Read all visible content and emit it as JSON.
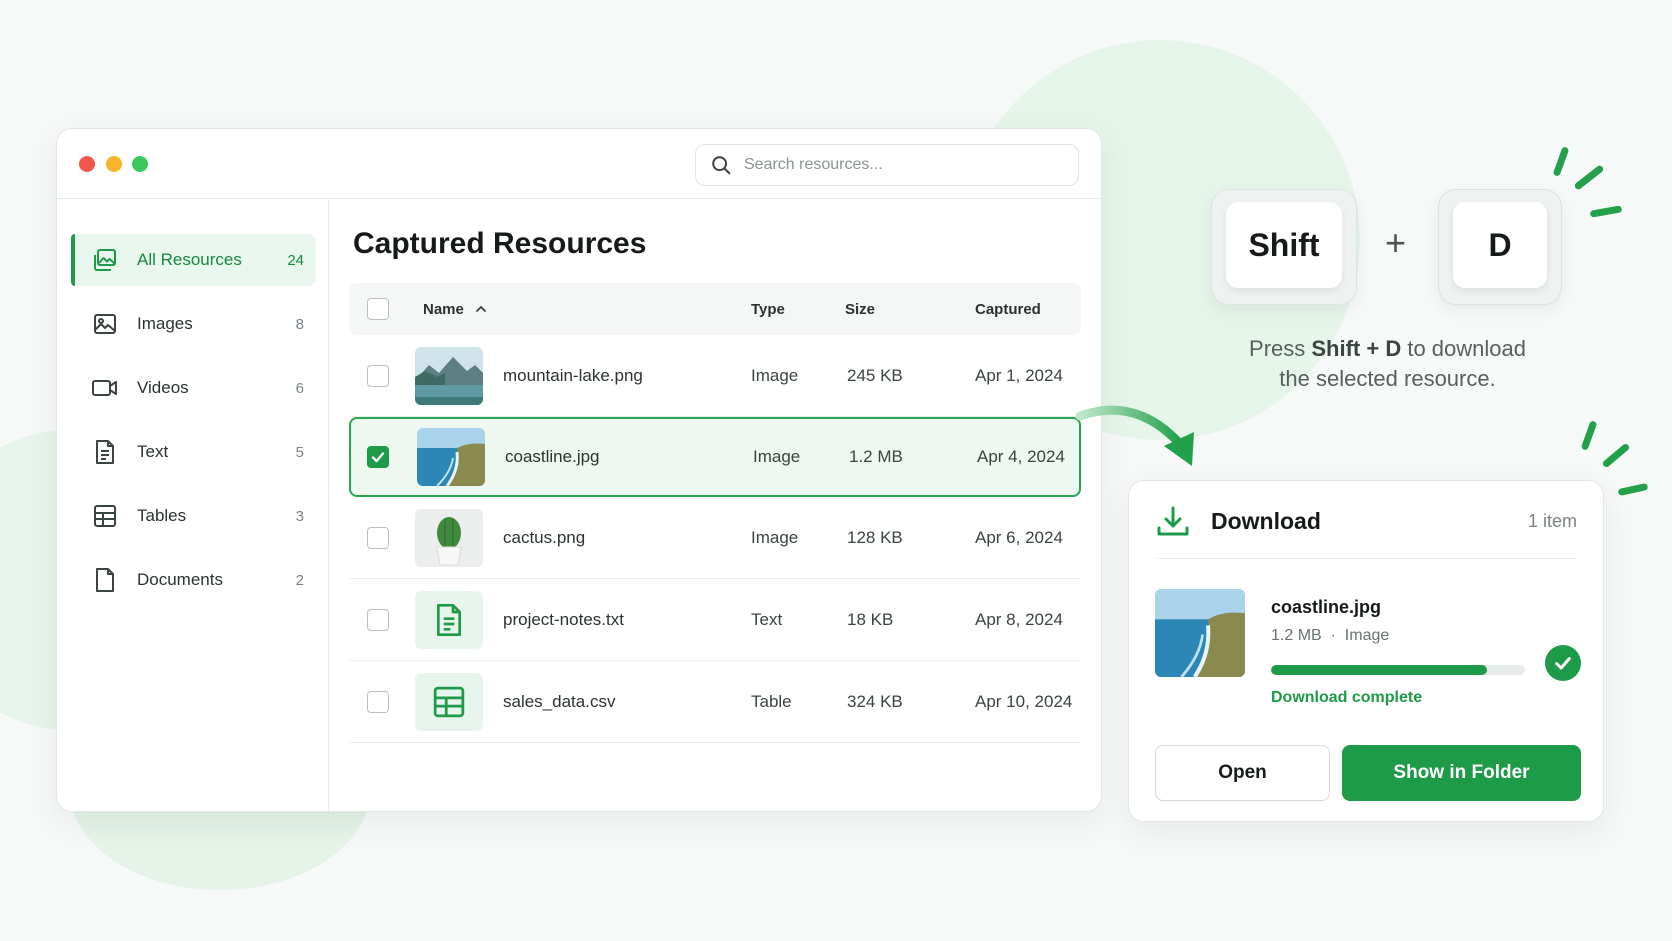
{
  "search": {
    "placeholder": "Search resources..."
  },
  "sidebar": {
    "items": [
      {
        "label": "All Resources",
        "count": "24",
        "icon": "gallery-icon"
      },
      {
        "label": "Images",
        "count": "8",
        "icon": "image-icon"
      },
      {
        "label": "Videos",
        "count": "6",
        "icon": "video-icon"
      },
      {
        "label": "Text",
        "count": "5",
        "icon": "text-file-icon"
      },
      {
        "label": "Tables",
        "count": "3",
        "icon": "table-icon"
      },
      {
        "label": "Documents",
        "count": "2",
        "icon": "document-icon"
      }
    ]
  },
  "main": {
    "title": "Captured Resources",
    "columns": {
      "name": "Name",
      "type": "Type",
      "size": "Size",
      "captured": "Captured"
    },
    "rows": [
      {
        "name": "mountain-lake.png",
        "type": "Image",
        "size": "245 KB",
        "captured": "Apr 1, 2024",
        "selected": false,
        "thumb": "mountain-lake-thumbnail"
      },
      {
        "name": "coastline.jpg",
        "type": "Image",
        "size": "1.2 MB",
        "captured": "Apr 4, 2024",
        "selected": true,
        "thumb": "coastline-thumbnail"
      },
      {
        "name": "cactus.png",
        "type": "Image",
        "size": "128 KB",
        "captured": "Apr 6, 2024",
        "selected": false,
        "thumb": "cactus-thumbnail"
      },
      {
        "name": "project-notes.txt",
        "type": "Text",
        "size": "18 KB",
        "captured": "Apr 8, 2024",
        "selected": false,
        "thumb": "text-file-icon"
      },
      {
        "name": "sales_data.csv",
        "type": "Table",
        "size": "324 KB",
        "captured": "Apr 10, 2024",
        "selected": false,
        "thumb": "table-icon"
      }
    ]
  },
  "shortcut": {
    "key1": "Shift",
    "plus": "+",
    "key2": "D",
    "hint_pre": "Press ",
    "hint_keys": "Shift + D",
    "hint_post": " to download",
    "hint_line2": "the selected resource."
  },
  "download": {
    "title": "Download",
    "count": "1 item",
    "file_name": "coastline.jpg",
    "file_size": "1.2 MB",
    "meta_sep": "·",
    "file_type": "Image",
    "progress": 0.85,
    "status": "Download complete",
    "open_label": "Open",
    "folder_label": "Show in Folder"
  },
  "colors": {
    "accent": "#1e9b48",
    "accent_light": "#e9f6ed"
  }
}
